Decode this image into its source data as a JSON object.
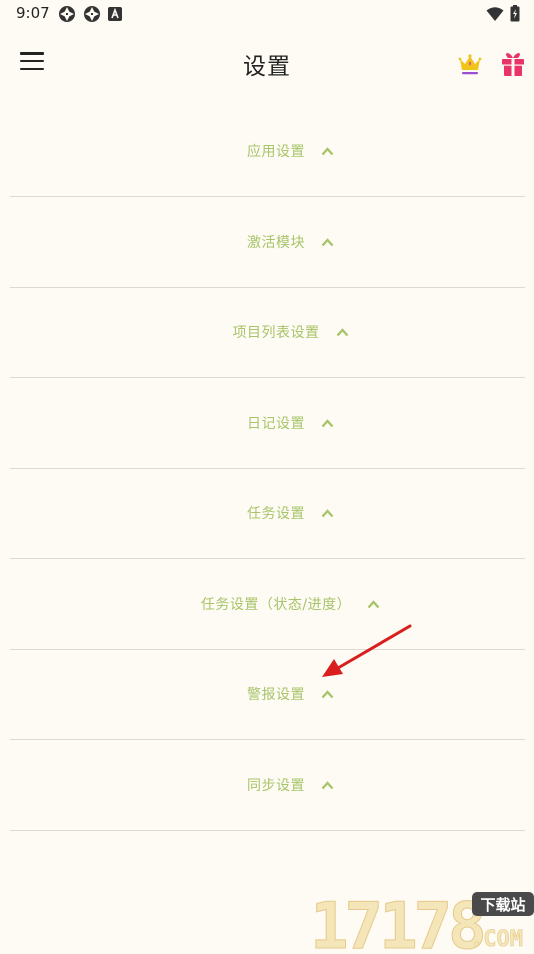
{
  "statusbar": {
    "time": "9:07",
    "left_icons": [
      "app-notification-icon",
      "app-notification-icon",
      "accessibility-icon"
    ],
    "right_icons": [
      "wifi-icon",
      "battery-icon"
    ]
  },
  "appbar": {
    "title": "设置",
    "menu_icon": "hamburger-menu-icon",
    "crown_icon": "crown-icon",
    "gift_icon": "gift-icon"
  },
  "sections": [
    {
      "label": "应用设置"
    },
    {
      "label": "激活模块"
    },
    {
      "label": "项目列表设置"
    },
    {
      "label": "日记设置"
    },
    {
      "label": "任务设置"
    },
    {
      "label": "任务设置（状态/进度）"
    },
    {
      "label": "警报设置"
    },
    {
      "label": "同步设置"
    }
  ],
  "watermark": {
    "number": "17178",
    "site": "下载站",
    "domain": ".COM"
  },
  "colors": {
    "background": "#fdfbf3",
    "accent_green": "#a8c46a",
    "divider": "#dcdad3",
    "annotation_arrow": "#d81e1e",
    "gift": "#e8336b",
    "crown": "#f2c31b"
  }
}
